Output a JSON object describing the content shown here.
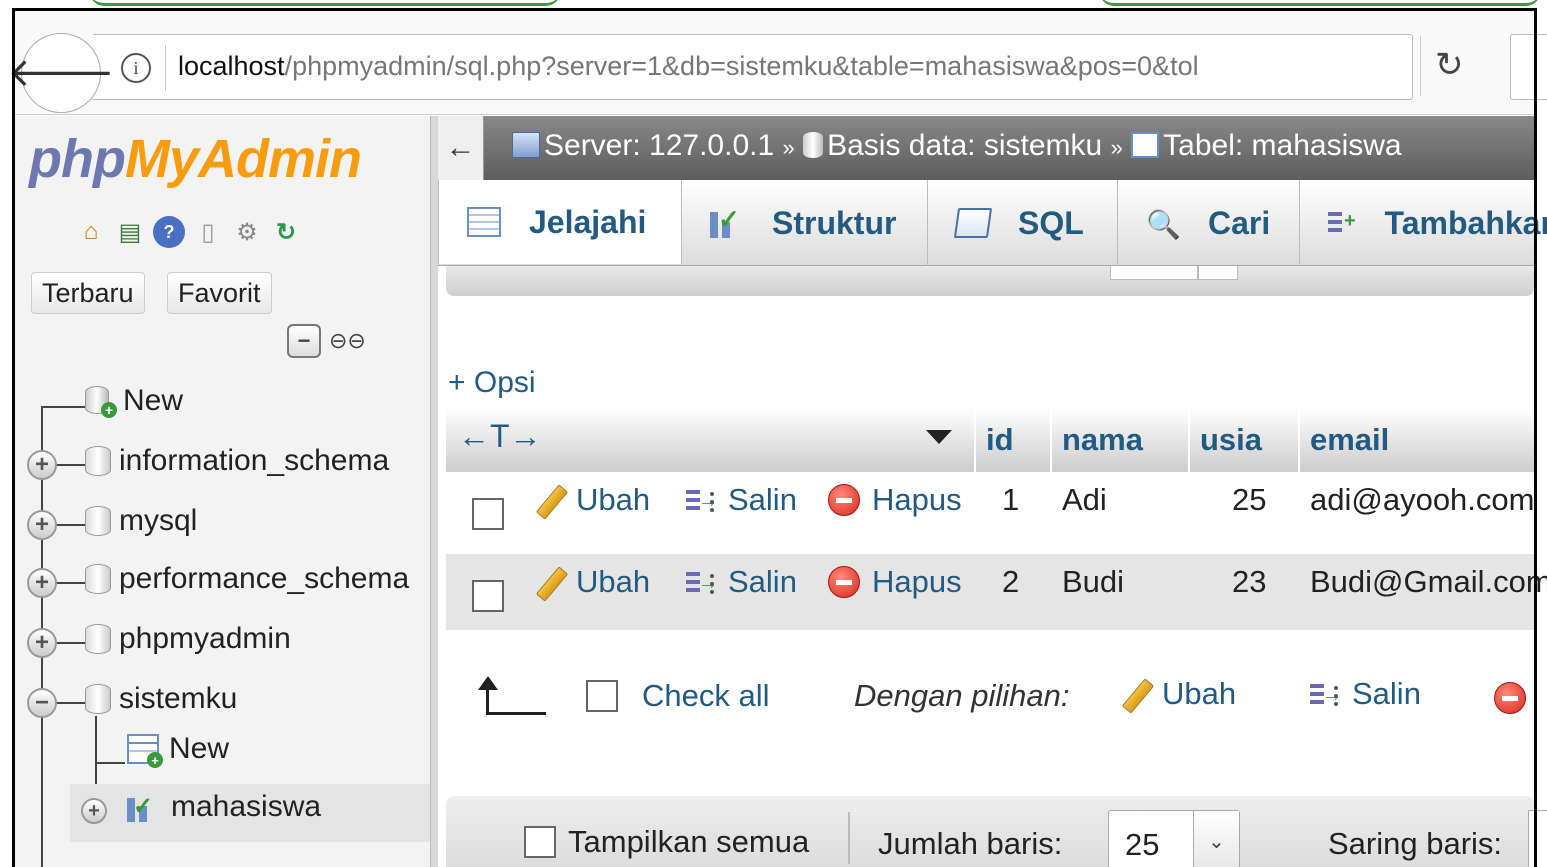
{
  "browser": {
    "url_host": "localhost",
    "url_path": "/phpmyadmin/sql.php?server=1&db=sistemku&table=mahasiswa&pos=0&tol"
  },
  "sidebar": {
    "logo_php": "php",
    "logo_myadmin": "MyAdmin",
    "recent_button": "Terbaru",
    "favorites_button": "Favorit",
    "tree": {
      "new": "New",
      "databases": [
        "information_schema",
        "mysql",
        "performance_schema",
        "phpmyadmin",
        "sistemku"
      ],
      "sistemku_children": {
        "new": "New",
        "table": "mahasiswa"
      }
    }
  },
  "breadcrumb": {
    "server": "Server: 127.0.0.1",
    "database": "Basis data: sistemku",
    "table": "Tabel: mahasiswa",
    "separator": "»"
  },
  "tabs": [
    "Jelajahi",
    "Struktur",
    "SQL",
    "Cari",
    "Tambahkan"
  ],
  "options_link": "+ Opsi",
  "table": {
    "arrows_glyph": "←T→",
    "columns": [
      "id",
      "nama",
      "usia",
      "email"
    ],
    "actions": {
      "edit": "Ubah",
      "copy": "Salin",
      "delete": "Hapus"
    },
    "rows": [
      {
        "id": "1",
        "nama": "Adi",
        "usia": "25",
        "email": "adi@ayooh.com"
      },
      {
        "id": "2",
        "nama": "Budi",
        "usia": "23",
        "email": "Budi@Gmail.com"
      }
    ]
  },
  "bulk": {
    "check_all": "Check all",
    "with_selected": "Dengan pilihan:",
    "edit": "Ubah",
    "copy": "Salin"
  },
  "footer": {
    "show_all": "Tampilkan semua",
    "rows_label": "Jumlah baris:",
    "rows_value": "25",
    "filter_label": "Saring baris:"
  },
  "colors": {
    "link_blue": "#235a81",
    "logo_php": "#6c78af",
    "logo_myadmin": "#f89c0e"
  }
}
